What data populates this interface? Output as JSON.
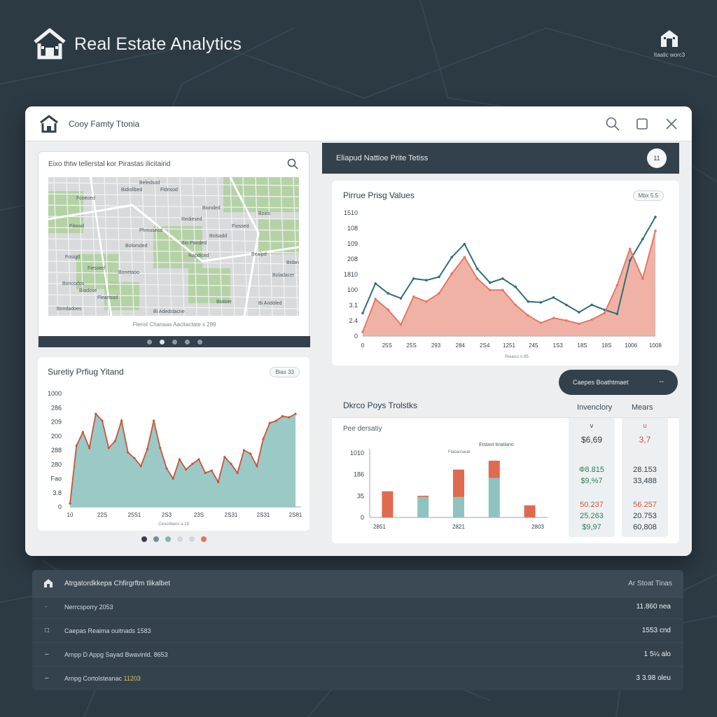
{
  "app": {
    "title": "Real Estate Analytics",
    "corner_badge_text": "Itaalic worc3"
  },
  "window": {
    "title": "Cooy Famty Ttonia",
    "controls": [
      "search-icon",
      "maximize-icon",
      "close-icon"
    ]
  },
  "map_card": {
    "title": "Eixo thtw tellerstal kor Pirastas ilicitairid",
    "caption": "Flenst Chanaas Aacitactate s 289",
    "labels": [
      "Beledsod",
      "Bidisfibed",
      "Fcoeced",
      "Fldnsod",
      "Bionded",
      "Rediesed",
      "Boxis",
      "Fibsod",
      "Phmosecd",
      "Bio Panded",
      "Bolsadd",
      "Fosigd",
      "Fiesoed",
      "Bonetaoo",
      "Rapdiced",
      "Beaipd",
      "Bidanaed",
      "Boricodos",
      "Biadose",
      "Fleartsod",
      "Bi Adedstacne",
      "Bioloer",
      "Bi Andoled",
      "Boladacer",
      "Bnndadoes",
      "Bolomded",
      "Fiossed"
    ],
    "pages": 5,
    "active_page": 1
  },
  "trend_card": {
    "title": "Suretiy Prfiug Yitand",
    "pill": "Bias 33",
    "caption": "Ceoodwers a 19"
  },
  "left_dots": {
    "colors": [
      "#33414c",
      "#6f8f97",
      "#84b2b0",
      "#d2d7da",
      "#d2d7da",
      "#e07558"
    ],
    "active": 0
  },
  "right_header": {
    "title": "Eliapud Nattioe Prite Tetiss",
    "badge": "11"
  },
  "price_card": {
    "title": "Pirrue Prisg Values",
    "pill": "Mbx  5.5",
    "caption": "Reuecs  o 85"
  },
  "compare_button": {
    "label": "Caepes Boathtmaet",
    "dash": "--"
  },
  "props": {
    "title": "Dkrco Poys Trolstks",
    "subtitle": "Pee dersatiy",
    "bar_annotation_1": "Etstast tinatiano",
    "bar_annotation_2": "Flabactaeat",
    "columns": [
      {
        "header": "Invenclory",
        "mark": "v",
        "top_value": "$6,69",
        "rows": [
          {
            "value": "Ф8.815",
            "color": "#2f7d55"
          },
          {
            "value": "$9,%7",
            "color": "#2f7d55"
          },
          {
            "value": "50.237",
            "color": "#d0553c"
          },
          {
            "value": "25.263",
            "color": "#2f7d55"
          },
          {
            "value": "$9,97",
            "color": "#2f7d55"
          }
        ],
        "top_color": "#2e3c48"
      },
      {
        "header": "Mears",
        "mark": "ʊ",
        "top_value": "3,7",
        "rows": [
          {
            "value": "28.153",
            "color": "#2e3c48"
          },
          {
            "value": "33,488",
            "color": "#2e3c48"
          },
          {
            "value": "56.257",
            "color": "#d0553c"
          },
          {
            "value": "20.753",
            "color": "#2e3c48"
          },
          {
            "value": "60,808",
            "color": "#2e3c48"
          }
        ],
        "top_color": "#d0553c"
      }
    ]
  },
  "summary": {
    "title": "Atrgatordkkepa Chfirgrftm tlikalbet",
    "right": "Ar Stoat Tinas",
    "rows": [
      {
        "icon": "·",
        "label": "Nerrcsporry 2053",
        "highlight": "",
        "value": "11.860 nea"
      },
      {
        "icon": "□",
        "label": "Caepas Reaima ouitnads 1583",
        "highlight": "",
        "value": "1553 cnd"
      },
      {
        "icon": "–",
        "label": "Arnpp D Appg Sayad Bwavinld. 8653",
        "highlight": "",
        "value": "1 5¼ alo"
      },
      {
        "icon": "–",
        "label": "Arnpg Cortolsteanac ",
        "highlight": "11203",
        "value": "3 3.98 oleu"
      }
    ]
  },
  "chart_data": [
    {
      "type": "area",
      "title": "Suretiy Prfiug Yitand",
      "yticks": [
        "1000",
        "286",
        "209",
        "200",
        "288",
        "280",
        "Fao",
        "3.8",
        "0"
      ],
      "xticks": [
        "10",
        "22S",
        "25S1",
        "2S3",
        "23S",
        "2S31",
        "2S31",
        "2S81"
      ],
      "x": [
        0,
        1,
        2,
        3,
        4,
        5,
        6,
        7,
        8,
        9,
        10,
        11,
        12,
        13,
        14,
        15,
        16,
        17,
        18,
        19,
        20,
        21,
        22,
        23,
        24,
        25,
        26,
        27,
        28,
        29,
        30,
        31,
        32,
        33,
        34,
        35
      ],
      "values": [
        30,
        540,
        660,
        520,
        820,
        760,
        520,
        580,
        760,
        480,
        430,
        360,
        510,
        760,
        520,
        340,
        250,
        420,
        330,
        380,
        420,
        300,
        320,
        220,
        440,
        380,
        300,
        500,
        470,
        360,
        600,
        740,
        760,
        800,
        790,
        820
      ]
    },
    {
      "type": "line",
      "title": "Pirrue Prisg Values",
      "yticks": [
        "1510",
        "108",
        "109",
        "208",
        "1810",
        "100",
        "3.1",
        "2.4",
        "0"
      ],
      "xticks": [
        "0",
        "25S",
        "25S",
        "293",
        "284",
        "2S4",
        "1251",
        "245",
        "1S3",
        "18S",
        "18S",
        "1006",
        "1008"
      ],
      "series": [
        {
          "name": "",
          "color": "#2f6f78",
          "values": [
            280,
            640,
            520,
            460,
            700,
            680,
            720,
            960,
            1120,
            820,
            650,
            700,
            600,
            420,
            410,
            470,
            380,
            290,
            380,
            320,
            270,
            920,
            1180,
            1450
          ]
        },
        {
          "name": "",
          "color": "#e07a68",
          "values": [
            50,
            450,
            320,
            140,
            480,
            420,
            520,
            760,
            960,
            700,
            560,
            560,
            380,
            250,
            160,
            220,
            190,
            150,
            200,
            280,
            620,
            1060,
            700,
            1280
          ]
        }
      ]
    },
    {
      "type": "bar",
      "title": "Pee dersatiy",
      "yticks": [
        "1010",
        "186",
        "35",
        "0"
      ],
      "xticks": [
        "2851",
        "2821",
        "2803"
      ],
      "categories": [
        "1",
        "2",
        "3",
        "4",
        "5"
      ],
      "series": [
        {
          "name": "",
          "color": "#8fc3c0",
          "values": [
            0,
            320,
            320,
            620,
            0
          ]
        },
        {
          "name": "",
          "color": "#e06a50",
          "values": [
            410,
            20,
            430,
            270,
            190
          ]
        }
      ]
    }
  ]
}
